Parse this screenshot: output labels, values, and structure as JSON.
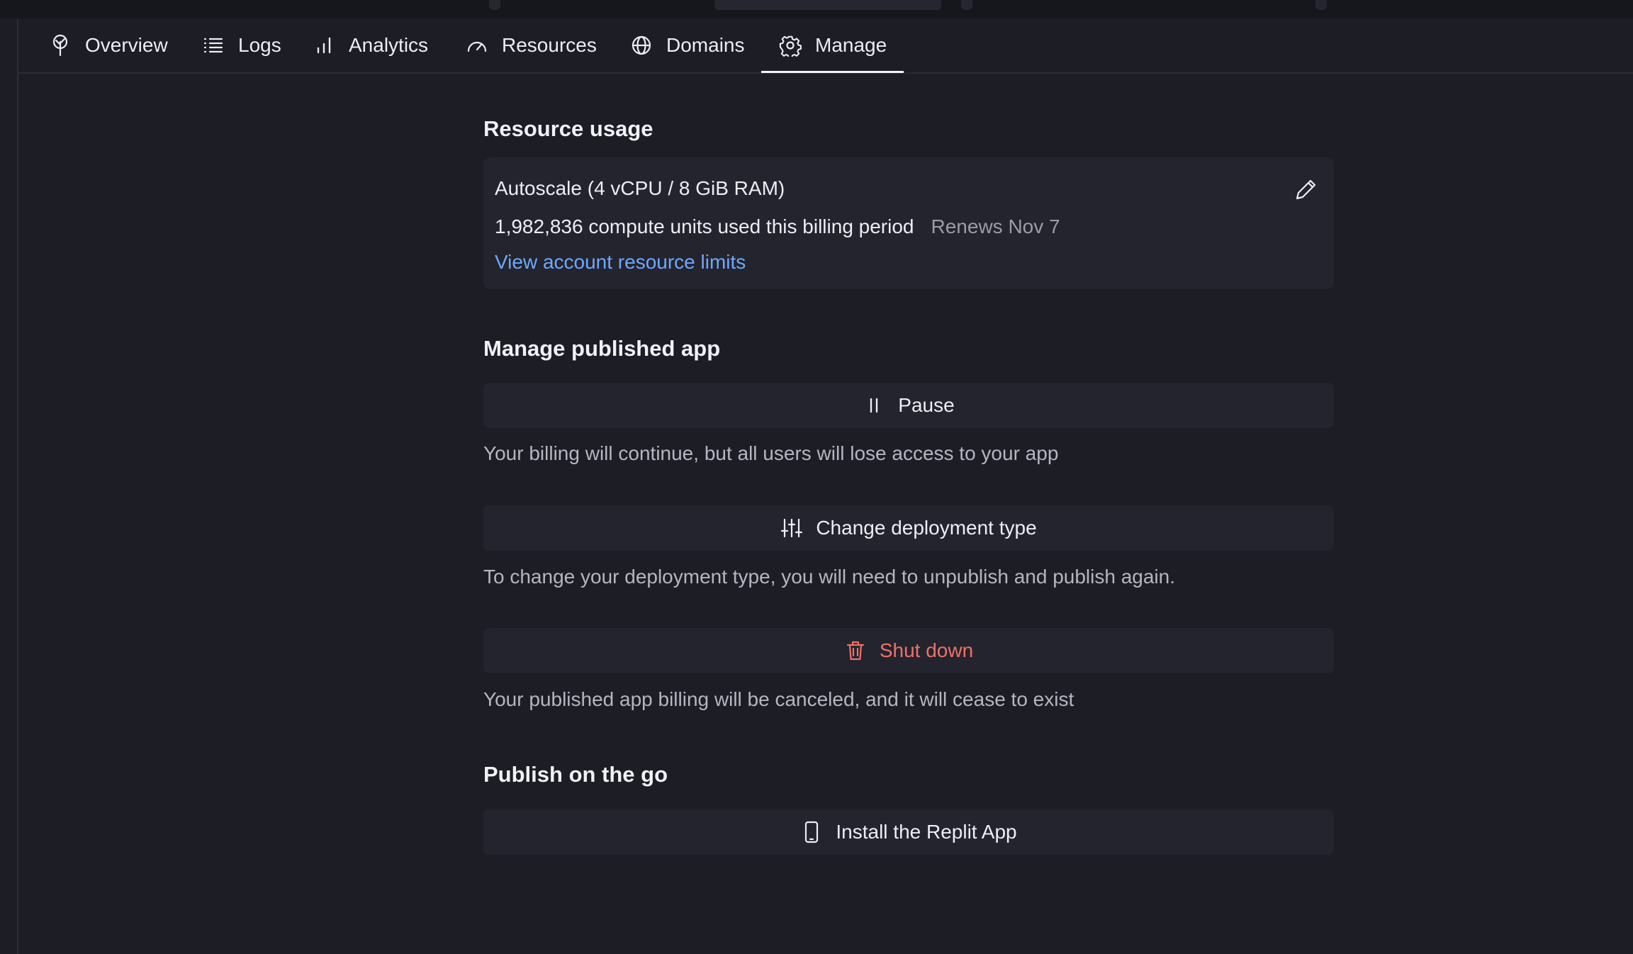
{
  "tabs": [
    {
      "label": "Overview",
      "icon": "tree-icon"
    },
    {
      "label": "Logs",
      "icon": "list-icon"
    },
    {
      "label": "Analytics",
      "icon": "bar-chart-icon"
    },
    {
      "label": "Resources",
      "icon": "gauge-icon"
    },
    {
      "label": "Domains",
      "icon": "globe-icon"
    },
    {
      "label": "Manage",
      "icon": "gear-icon",
      "active": true
    }
  ],
  "resource_usage": {
    "title": "Resource usage",
    "plan": "Autoscale (4 vCPU / 8 GiB RAM)",
    "compute_units": "1,982,836 compute units used this billing period",
    "renews": "Renews Nov 7",
    "limits_link": "View account resource limits"
  },
  "manage": {
    "title": "Manage published app",
    "pause_label": "Pause",
    "pause_desc": "Your billing will continue, but all users will lose access to your app",
    "change_label": "Change deployment type",
    "change_desc": "To change your deployment type, you will need to unpublish and publish again.",
    "shutdown_label": "Shut down",
    "shutdown_desc": "Your published app billing will be canceled, and it will cease to exist"
  },
  "publish_go": {
    "title": "Publish on the go",
    "install_label": "Install the Replit App"
  },
  "colors": {
    "background": "#1c1d25",
    "card": "#23242d",
    "link": "#6ea8ff",
    "danger": "#f0706a"
  }
}
